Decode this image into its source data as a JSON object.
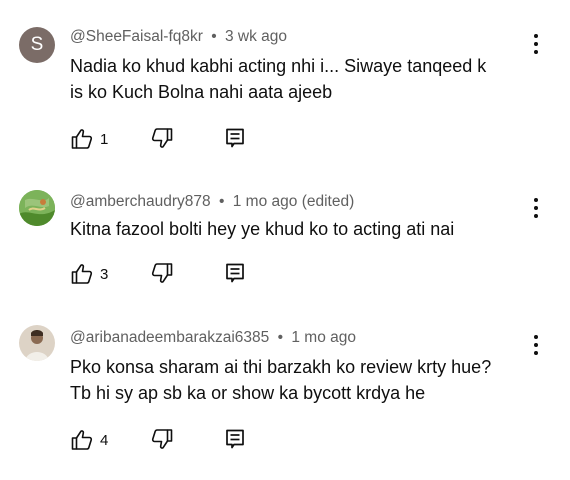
{
  "comments": [
    {
      "avatar_letter": "S",
      "avatar_color": "#7b6c67",
      "handle": "@SheeFaisal-fq8kr",
      "separator": "•",
      "time": "3 wk ago",
      "edited": "",
      "text_lines": [
        "Nadia ko khud kabhi acting  nhi i... Siwaye tanqeed k",
        "is ko Kuch Bolna nahi aata ajeeb"
      ],
      "likes": "1"
    },
    {
      "avatar_letter": "",
      "avatar_color": "#6aa84f",
      "handle": "@amberchaudry878",
      "separator": "•",
      "time": "1 mo ago",
      "edited": "(edited)",
      "text_lines": [
        "Kitna fazool bolti hey ye khud ko to acting ati nai"
      ],
      "likes": "3"
    },
    {
      "avatar_letter": "",
      "avatar_color": "#c9b8a8",
      "handle": "@aribanadeembarakzai6385",
      "separator": "•",
      "time": "1 mo ago",
      "edited": "",
      "text_lines": [
        "Pko konsa sharam ai thi barzakh ko review krty hue?",
        "Tb hi sy ap sb ka or show ka bycott krdya he"
      ],
      "likes": "4"
    }
  ],
  "icons": {
    "like": "thumbs-up-icon",
    "dislike": "thumbs-down-icon",
    "reply": "reply-icon",
    "menu": "more-vertical-icon"
  }
}
